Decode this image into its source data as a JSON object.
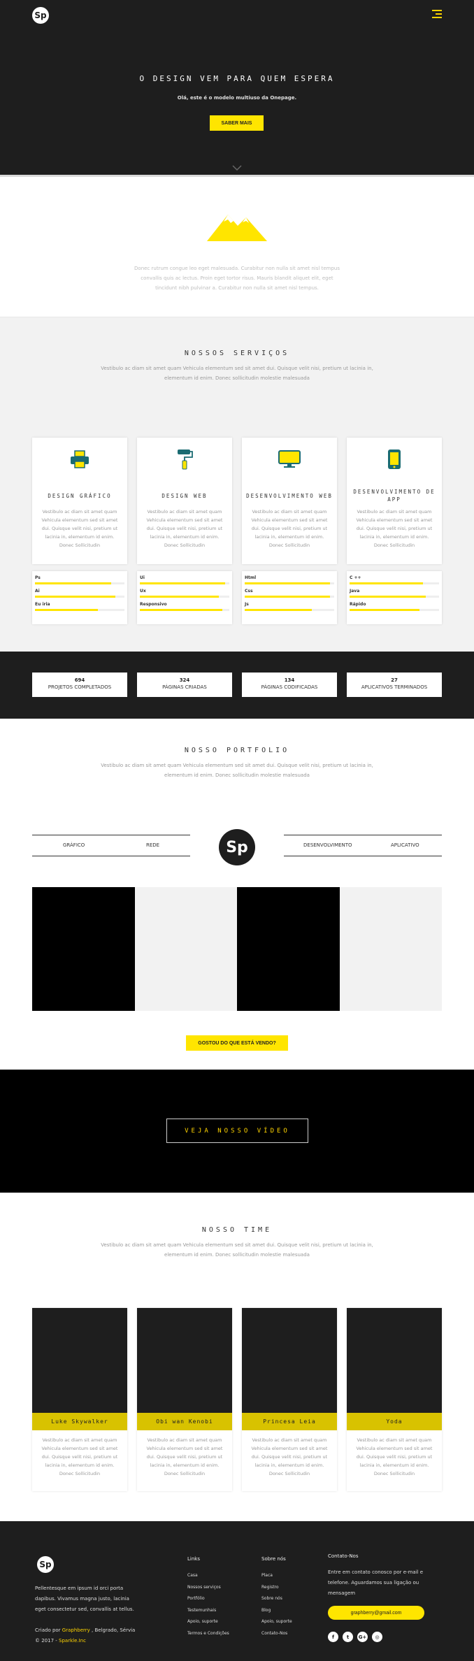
{
  "hero": {
    "logo": "Sp",
    "title": "O DESIGN VEM PARA QUEM ESPERA",
    "subtitle": "Olá, este é o modelo multiuso da Onepage.",
    "cta_label": "SABER MAIS"
  },
  "intro": {
    "text": "Donec rutrum congue leo eget malesuada. Curabitur non nulla sit amet nisl tempus convallis quis ac lectus. Proin eget tortor risus. Mauris blandit aliquet elit, eget tincidunt nibh pulvinar a. Curabitur non nulla sit amet nisl tempus."
  },
  "services": {
    "title": "NOSSOS SERVIÇOS",
    "description": "Vestibulo ac diam sit amet quam Vehicula elementum sed sit amet dui. Quisque velit nisi, pretium ut lacinia in, elementum id enim. Donec sollicitudin molestie malesuada",
    "cards": [
      {
        "title": "DESIGN GRÁFICO",
        "icon": "printer-icon",
        "text": "Vestibulo ac diam sit amet quam Vehicula elementum sed sit amet dui. Quisque velit nisi, pretium ut lacinia in, elementum id enim. Donec Sollicitudin"
      },
      {
        "title": "DESIGN WEB",
        "icon": "paint-roller-icon",
        "text": "Vestibulo ac diam sit amet quam Vehicula elementum sed sit amet dui. Quisque velit nisi, pretium ut lacinia in, elementum id enim. Donec Sollicitudin"
      },
      {
        "title": "DESENVOLVIMENTO WEB",
        "icon": "monitor-icon",
        "text": "Vestibulo ac diam sit amet quam Vehicula elementum sed sit amet dui. Quisque velit nisi, pretium ut lacinia in, elementum id enim. Donec Sollicitudin"
      },
      {
        "title": "DESENVOLVIMENTO DE APP",
        "icon": "smartphone-icon",
        "text": "Vestibulo ac diam sit amet quam Vehicula elementum sed sit amet dui. Quisque velit nisi, pretium ut lacinia in, elementum id enim. Donec Sollicitudin"
      }
    ],
    "skills": [
      [
        {
          "label": "Ps",
          "level": 0.85
        },
        {
          "label": "Ai",
          "level": 0.9
        },
        {
          "label": "Eu iria",
          "level": 0.7
        }
      ],
      [
        {
          "label": "Ui",
          "level": 0.95
        },
        {
          "label": "Ux",
          "level": 0.88
        },
        {
          "label": "Responsivo",
          "level": 0.92
        }
      ],
      [
        {
          "label": "Html",
          "level": 0.95
        },
        {
          "label": "Css",
          "level": 0.95
        },
        {
          "label": "Js",
          "level": 0.75
        }
      ],
      [
        {
          "label": "C ++",
          "level": 0.82
        },
        {
          "label": "Java",
          "level": 0.85
        },
        {
          "label": "Rápido",
          "level": 0.78
        }
      ]
    ]
  },
  "counters": [
    {
      "number": "694",
      "label": "PROJETOS COMPLETADOS"
    },
    {
      "number": "324",
      "label": "PÁGINAS CRIADAS"
    },
    {
      "number": "134",
      "label": "PÁGINAS CODIFICADAS"
    },
    {
      "number": "27",
      "label": "APLICATIVOS TERMINADOS"
    }
  ],
  "portfolio": {
    "title": "NOSSO PORTFOLIO",
    "description": "Vestibulo ac diam sit amet quam Vehicula elementum sed sit amet dui. Quisque velit nisi, pretium ut lacinia in, elementum id enim. Donec sollicitudin molestie malesuada",
    "filters": [
      "GRÁFICO",
      "REDE",
      "DESENVOLVIMENTO",
      "APLICATIVO"
    ],
    "logo": "Sp",
    "button_label": "GOSTOU DO QUE ESTÁ VENDO?"
  },
  "video": {
    "button_label": "VEJA NOSSO VÍDEO"
  },
  "team": {
    "title": "NOSSO TIME",
    "description": "Vestibulo ac diam sit amet quam Vehicula elementum sed sit amet dui. Quisque velit nisi, pretium ut lacinia in, elementum id enim. Donec sollicitudin molestie malesuada",
    "members": [
      {
        "name": "Luke Skywalker",
        "text": "Vestibulo ac diam sit amet quam Vehicula elementum sed sit amet dui. Quisque velit nisi, pretium ut lacinia in, elementum id enim. Donec Sollicitudin"
      },
      {
        "name": "Obi wan Kenobi",
        "text": "Vestibulo ac diam sit amet quam Vehicula elementum sed sit amet dui. Quisque velit nisi, pretium ut lacinia in, elementum id enim. Donec Sollicitudin"
      },
      {
        "name": "Princesa Leia",
        "text": "Vestibulo ac diam sit amet quam Vehicula elementum sed sit amet dui. Quisque velit nisi, pretium ut lacinia in, elementum id enim. Donec Sollicitudin"
      },
      {
        "name": "Yoda",
        "text": "Vestibulo ac diam sit amet quam Vehicula elementum sed sit amet dui. Quisque velit nisi, pretium ut lacinia in, elementum id enim. Donec Sollicitudin"
      }
    ]
  },
  "footer": {
    "logo": "Sp",
    "about": "Pellentesque em ipsum id orci porta dapibus. Vivamus magna justo, lacinia eget consectetur sed, convallis at tellus.",
    "credit_prefix": "Criado por",
    "credit_brand": "Graphberry",
    "credit_suffix": ", Belgrado, Sérvia",
    "copyright_prefix": "© 2017 -",
    "copyright_brand": "Sparkle.Inc",
    "links_title": "Links",
    "links": [
      "Casa",
      "Nossos serviços",
      "Portfólio",
      "Testemunhais",
      "Apoio, suporte",
      "Termos e Condições"
    ],
    "about_title": "Sobre nós",
    "about_links": [
      "Placa",
      "Registro",
      "Sobre nós",
      "Blog",
      "Apoio, suporte",
      "Contato-Nos"
    ],
    "contact_title": "Contato-Nos",
    "contact_text": "Entre em contato conosco por e-mail e telefone. Aguardamos sua ligação ou mensagem",
    "email": "graphberry@gmail.com",
    "socials": [
      {
        "icon": "facebook-icon",
        "glyph": "f"
      },
      {
        "icon": "twitter-icon",
        "glyph": "t"
      },
      {
        "icon": "google-plus-icon",
        "glyph": "G+"
      },
      {
        "icon": "instagram-icon",
        "glyph": "◎"
      }
    ]
  },
  "colors": {
    "accent": "#ffe500",
    "dark": "#1e1e1e",
    "light": "#f2f2f2",
    "team_bar": "#d8c200"
  }
}
